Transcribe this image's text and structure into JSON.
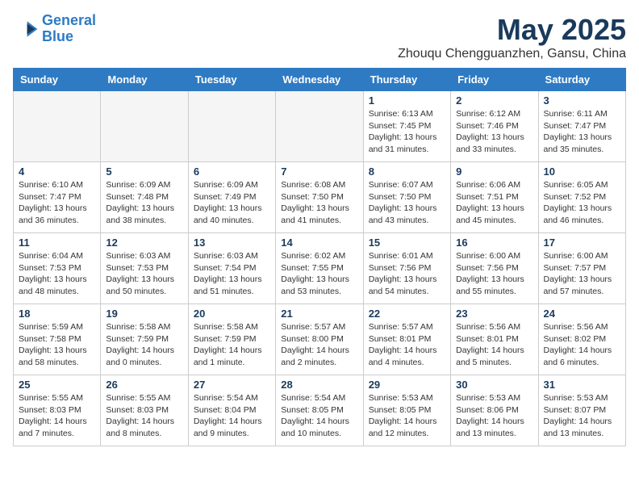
{
  "logo": {
    "line1": "General",
    "line2": "Blue"
  },
  "title": "May 2025",
  "location": "Zhouqu Chengguanzhen, Gansu, China",
  "weekdays": [
    "Sunday",
    "Monday",
    "Tuesday",
    "Wednesday",
    "Thursday",
    "Friday",
    "Saturday"
  ],
  "weeks": [
    [
      {
        "day": "",
        "info": ""
      },
      {
        "day": "",
        "info": ""
      },
      {
        "day": "",
        "info": ""
      },
      {
        "day": "",
        "info": ""
      },
      {
        "day": "1",
        "info": "Sunrise: 6:13 AM\nSunset: 7:45 PM\nDaylight: 13 hours\nand 31 minutes."
      },
      {
        "day": "2",
        "info": "Sunrise: 6:12 AM\nSunset: 7:46 PM\nDaylight: 13 hours\nand 33 minutes."
      },
      {
        "day": "3",
        "info": "Sunrise: 6:11 AM\nSunset: 7:47 PM\nDaylight: 13 hours\nand 35 minutes."
      }
    ],
    [
      {
        "day": "4",
        "info": "Sunrise: 6:10 AM\nSunset: 7:47 PM\nDaylight: 13 hours\nand 36 minutes."
      },
      {
        "day": "5",
        "info": "Sunrise: 6:09 AM\nSunset: 7:48 PM\nDaylight: 13 hours\nand 38 minutes."
      },
      {
        "day": "6",
        "info": "Sunrise: 6:09 AM\nSunset: 7:49 PM\nDaylight: 13 hours\nand 40 minutes."
      },
      {
        "day": "7",
        "info": "Sunrise: 6:08 AM\nSunset: 7:50 PM\nDaylight: 13 hours\nand 41 minutes."
      },
      {
        "day": "8",
        "info": "Sunrise: 6:07 AM\nSunset: 7:50 PM\nDaylight: 13 hours\nand 43 minutes."
      },
      {
        "day": "9",
        "info": "Sunrise: 6:06 AM\nSunset: 7:51 PM\nDaylight: 13 hours\nand 45 minutes."
      },
      {
        "day": "10",
        "info": "Sunrise: 6:05 AM\nSunset: 7:52 PM\nDaylight: 13 hours\nand 46 minutes."
      }
    ],
    [
      {
        "day": "11",
        "info": "Sunrise: 6:04 AM\nSunset: 7:53 PM\nDaylight: 13 hours\nand 48 minutes."
      },
      {
        "day": "12",
        "info": "Sunrise: 6:03 AM\nSunset: 7:53 PM\nDaylight: 13 hours\nand 50 minutes."
      },
      {
        "day": "13",
        "info": "Sunrise: 6:03 AM\nSunset: 7:54 PM\nDaylight: 13 hours\nand 51 minutes."
      },
      {
        "day": "14",
        "info": "Sunrise: 6:02 AM\nSunset: 7:55 PM\nDaylight: 13 hours\nand 53 minutes."
      },
      {
        "day": "15",
        "info": "Sunrise: 6:01 AM\nSunset: 7:56 PM\nDaylight: 13 hours\nand 54 minutes."
      },
      {
        "day": "16",
        "info": "Sunrise: 6:00 AM\nSunset: 7:56 PM\nDaylight: 13 hours\nand 55 minutes."
      },
      {
        "day": "17",
        "info": "Sunrise: 6:00 AM\nSunset: 7:57 PM\nDaylight: 13 hours\nand 57 minutes."
      }
    ],
    [
      {
        "day": "18",
        "info": "Sunrise: 5:59 AM\nSunset: 7:58 PM\nDaylight: 13 hours\nand 58 minutes."
      },
      {
        "day": "19",
        "info": "Sunrise: 5:58 AM\nSunset: 7:59 PM\nDaylight: 14 hours\nand 0 minutes."
      },
      {
        "day": "20",
        "info": "Sunrise: 5:58 AM\nSunset: 7:59 PM\nDaylight: 14 hours\nand 1 minute."
      },
      {
        "day": "21",
        "info": "Sunrise: 5:57 AM\nSunset: 8:00 PM\nDaylight: 14 hours\nand 2 minutes."
      },
      {
        "day": "22",
        "info": "Sunrise: 5:57 AM\nSunset: 8:01 PM\nDaylight: 14 hours\nand 4 minutes."
      },
      {
        "day": "23",
        "info": "Sunrise: 5:56 AM\nSunset: 8:01 PM\nDaylight: 14 hours\nand 5 minutes."
      },
      {
        "day": "24",
        "info": "Sunrise: 5:56 AM\nSunset: 8:02 PM\nDaylight: 14 hours\nand 6 minutes."
      }
    ],
    [
      {
        "day": "25",
        "info": "Sunrise: 5:55 AM\nSunset: 8:03 PM\nDaylight: 14 hours\nand 7 minutes."
      },
      {
        "day": "26",
        "info": "Sunrise: 5:55 AM\nSunset: 8:03 PM\nDaylight: 14 hours\nand 8 minutes."
      },
      {
        "day": "27",
        "info": "Sunrise: 5:54 AM\nSunset: 8:04 PM\nDaylight: 14 hours\nand 9 minutes."
      },
      {
        "day": "28",
        "info": "Sunrise: 5:54 AM\nSunset: 8:05 PM\nDaylight: 14 hours\nand 10 minutes."
      },
      {
        "day": "29",
        "info": "Sunrise: 5:53 AM\nSunset: 8:05 PM\nDaylight: 14 hours\nand 12 minutes."
      },
      {
        "day": "30",
        "info": "Sunrise: 5:53 AM\nSunset: 8:06 PM\nDaylight: 14 hours\nand 13 minutes."
      },
      {
        "day": "31",
        "info": "Sunrise: 5:53 AM\nSunset: 8:07 PM\nDaylight: 14 hours\nand 13 minutes."
      }
    ]
  ]
}
